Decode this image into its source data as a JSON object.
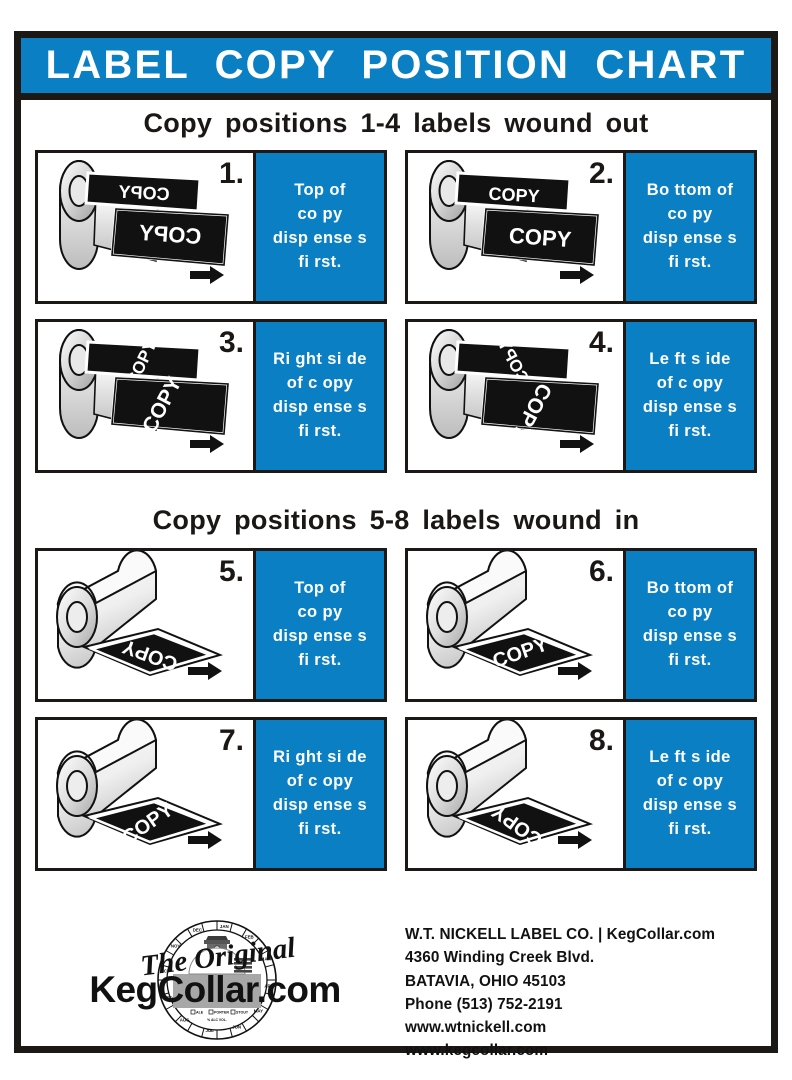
{
  "header": {
    "title": "LABEL  COPY  POSITION  CHART",
    "banner_color": "#0a7fc4",
    "text_color": "#ffffff"
  },
  "sections": [
    {
      "heading_prefix": "Copy positions",
      "heading_suffix": "1-4 labels  wound out",
      "heading_full": "Copy positions   1-4 labels  wound out",
      "wind": "out"
    },
    {
      "heading_prefix": "Copy positions",
      "heading_suffix": "5-8 labels  wound in",
      "heading_full": "Copy positions   5-8 labels  wound in",
      "wind": "in"
    }
  ],
  "panels": [
    {
      "number": "1.",
      "label_text": "COPY",
      "copy_rotation": 180,
      "wind": "out",
      "caption_lines": [
        "Top of",
        "co py",
        "disp ense s",
        "fi rst."
      ],
      "caption_plain": "Top of copy dispenses first."
    },
    {
      "number": "2.",
      "label_text": "COPY",
      "copy_rotation": 0,
      "wind": "out",
      "caption_lines": [
        "Bo ttom  of",
        "co py",
        "disp ense s",
        "fi rst."
      ],
      "caption_plain": "Bottom of copy dispenses first."
    },
    {
      "number": "3.",
      "label_text": "COPY",
      "copy_rotation": -90,
      "wind": "out",
      "caption_lines": [
        "Ri ght si de",
        "of c opy",
        "disp ense s",
        "fi rst."
      ],
      "caption_plain": "Right side of copy dispenses first."
    },
    {
      "number": "4.",
      "label_text": "COPY",
      "copy_rotation": 90,
      "wind": "out",
      "caption_lines": [
        "Le ft s ide",
        "of c opy",
        "disp ense s",
        "fi rst."
      ],
      "caption_plain": "Left side of copy dispenses first."
    },
    {
      "number": "5.",
      "label_text": "COPY",
      "copy_rotation": 180,
      "wind": "in",
      "caption_lines": [
        "Top of",
        "co py",
        "disp ense s",
        "fi rst."
      ],
      "caption_plain": "Top of copy dispenses first."
    },
    {
      "number": "6.",
      "label_text": "COPY",
      "copy_rotation": 0,
      "wind": "in",
      "caption_lines": [
        "Bo ttom  of",
        "co py",
        "disp ense s",
        "fi rst."
      ],
      "caption_plain": "Bottom of copy dispenses first."
    },
    {
      "number": "7.",
      "label_text": "COPY",
      "copy_rotation": 0,
      "wind": "in",
      "caption_lines": [
        "Ri ght si de",
        "of c opy",
        "disp ense s",
        "fi rst."
      ],
      "caption_plain": "Right side of copy dispenses first."
    },
    {
      "number": "8.",
      "label_text": "COPY",
      "copy_rotation": 180,
      "wind": "in",
      "caption_lines": [
        "Le ft s ide",
        "of c opy",
        "disp ense s",
        "fi rst."
      ],
      "caption_plain": "Left side of copy dispenses first."
    }
  ],
  "footer": {
    "logo": {
      "script_text": "The Original",
      "wordmark": "KegCollar.com",
      "ring_months": [
        "JAN",
        "FEB",
        "MAR",
        "APR",
        "MAY",
        "JUN",
        "JUL",
        "AUG",
        "SEP",
        "OCT",
        "NOV",
        "DEC"
      ],
      "checkboxes": [
        "ALE",
        "PORTER",
        "STOUT"
      ],
      "alc_label": "% ALC VOL."
    },
    "company": [
      "W.T. NICKELL LABEL CO. | KegCollar.com",
      "4360 Winding Creek Blvd.",
      "BATAVIA, OHIO  45103",
      "Phone (513) 752-2191",
      "www.wtnickell.com",
      "www.kegcollar.com"
    ]
  },
  "colors": {
    "brand_blue": "#0a7fc4",
    "frame_black": "#1c1815",
    "paper_white": "#ffffff"
  }
}
